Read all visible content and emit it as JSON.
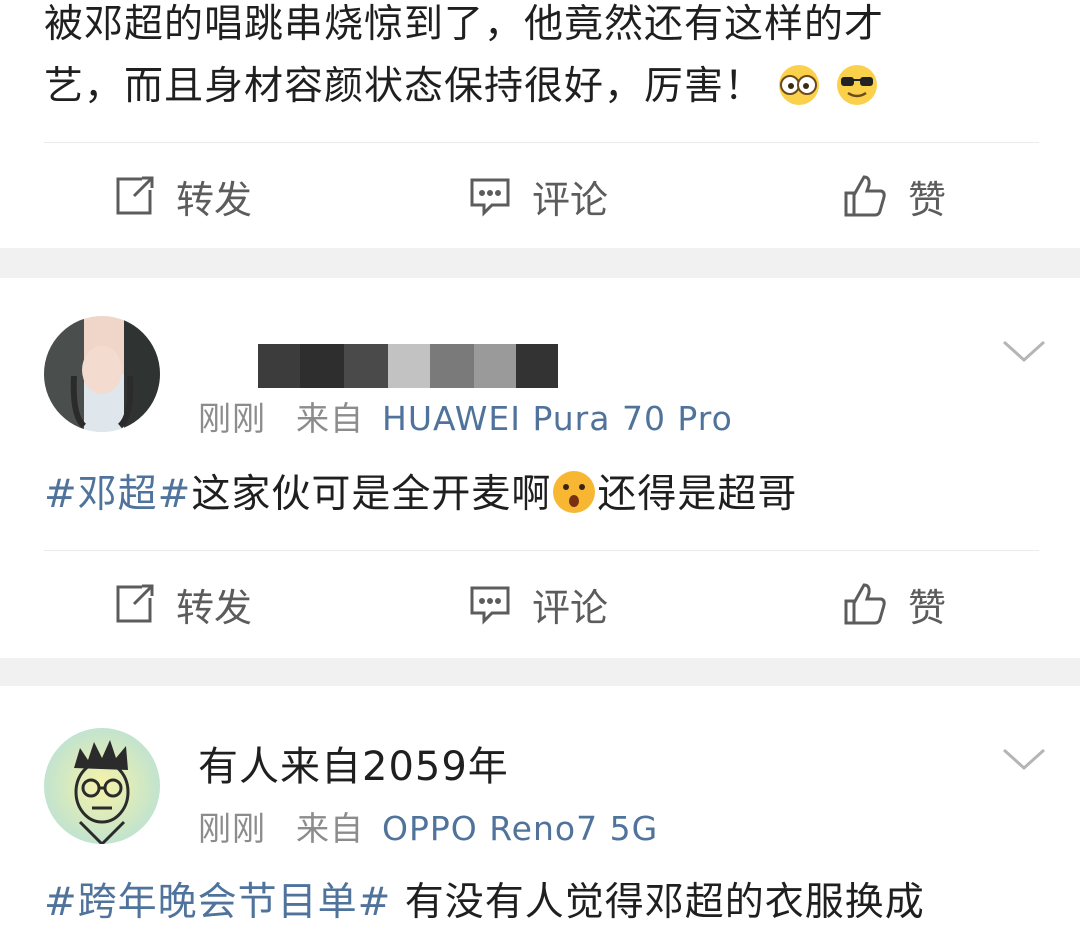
{
  "post1": {
    "text_line1": "被邓超的唱跳串烧惊到了，他竟然还有这样的才",
    "text_line2": "艺，而且身材容颜状态保持很好，厉害！",
    "actions": {
      "repost": "转发",
      "comment": "评论",
      "like": "赞"
    }
  },
  "post2": {
    "meta": {
      "time": "刚刚",
      "source_prefix": "来自",
      "device": "HUAWEI Pura 70 Pro"
    },
    "hashtag": "#邓超#",
    "text_a": "这家伙可是全开麦啊",
    "text_b": "还得是超哥",
    "actions": {
      "repost": "转发",
      "comment": "评论",
      "like": "赞"
    }
  },
  "post3": {
    "username": "有人来自2059年",
    "meta": {
      "time": "刚刚",
      "source_prefix": "来自",
      "device": "OPPO Reno7 5G"
    },
    "hashtag": "#跨年晚会节目单#",
    "text": " 有没有人觉得邓超的衣服换成"
  },
  "colors": {
    "link": "#50739c",
    "meta": "#8c8c8c",
    "separator": "#f1f1f1",
    "action": "#5c5c5c"
  },
  "icons": [
    "repost-icon",
    "comment-icon",
    "like-icon",
    "chevron-down-icon",
    "emoji-glasses",
    "emoji-sunglasses",
    "emoji-surprised"
  ]
}
